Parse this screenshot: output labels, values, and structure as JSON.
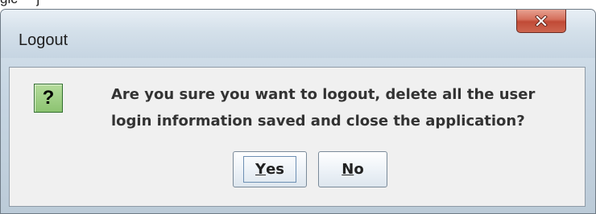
{
  "window": {
    "title": "Logout"
  },
  "dialog": {
    "icon": "question-icon",
    "icon_glyph": "?",
    "message_line1": "Are you sure you want to logout, delete all the user",
    "message_line2": "login information saved and close the application?"
  },
  "buttons": {
    "yes": {
      "mnemonic": "Y",
      "rest": "es"
    },
    "no": {
      "mnemonic": "N",
      "rest": "o"
    }
  },
  "colors": {
    "close_button": "#c75a45",
    "question_icon_bg": "#9fcf84",
    "content_bg": "#f0f0f0"
  }
}
